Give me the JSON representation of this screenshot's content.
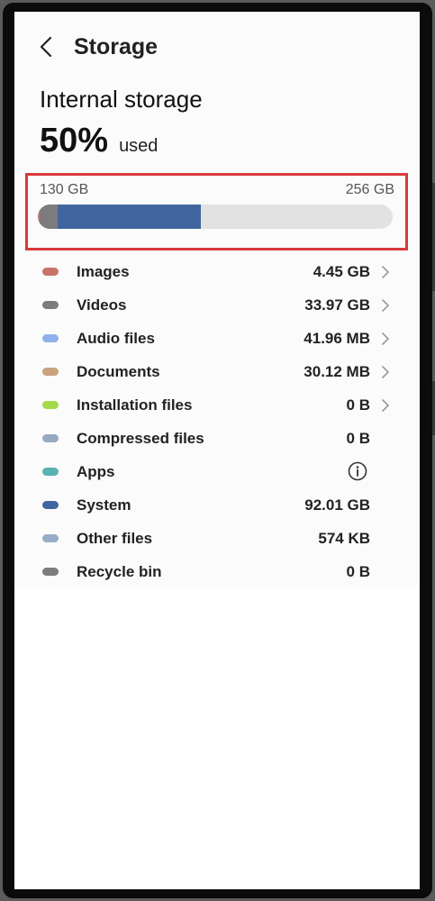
{
  "header": {
    "title": "Storage"
  },
  "section": {
    "title": "Internal storage",
    "used_percent": "50%",
    "used_label": "used"
  },
  "storage_bar": {
    "used_label": "130 GB",
    "total_label": "256 GB",
    "used_fraction": 0.5
  },
  "colors": {
    "highlight": "#d9393b",
    "bar_track": "#e2e2e2"
  },
  "categories": [
    {
      "label": "Images",
      "value": "4.45 GB",
      "color": "#c97468",
      "trailing": "chevron-right-icon"
    },
    {
      "label": "Videos",
      "value": "33.97 GB",
      "color": "#7d7b7d",
      "trailing": "chevron-right-icon"
    },
    {
      "label": "Audio files",
      "value": "41.96 MB",
      "color": "#8fb0ea",
      "trailing": "chevron-right-icon"
    },
    {
      "label": "Documents",
      "value": "30.12 MB",
      "color": "#c9a27e",
      "trailing": "chevron-right-icon"
    },
    {
      "label": "Installation files",
      "value": "0 B",
      "color": "#a5d94a",
      "trailing": "chevron-right-icon"
    },
    {
      "label": "Compressed files",
      "value": "0 B",
      "color": "#97a9be",
      "trailing": ""
    },
    {
      "label": "Apps",
      "value": "",
      "color": "#5bb2b3",
      "trailing": "info-icon"
    },
    {
      "label": "System",
      "value": "92.01 GB",
      "color": "#41669f",
      "trailing": ""
    },
    {
      "label": "Other files",
      "value": "574 KB",
      "color": "#99acc6",
      "trailing": ""
    },
    {
      "label": "Recycle bin",
      "value": "0 B",
      "color": "#7d7d7d",
      "trailing": ""
    }
  ]
}
